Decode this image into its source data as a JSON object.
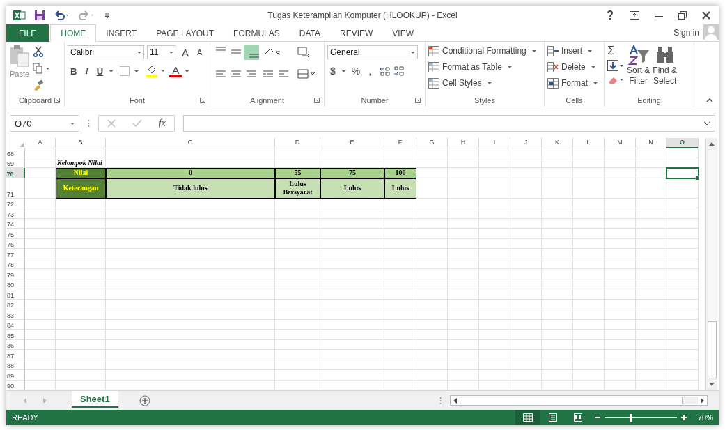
{
  "title_bar": {
    "title": "Tugas Keterampilan Komputer (HLOOKUP) - Excel"
  },
  "tabs": [
    {
      "label": "FILE",
      "kind": "file",
      "selected": false
    },
    {
      "label": "HOME",
      "kind": "tab",
      "selected": true
    },
    {
      "label": "INSERT",
      "kind": "tab",
      "selected": false
    },
    {
      "label": "PAGE LAYOUT",
      "kind": "tab",
      "selected": false
    },
    {
      "label": "FORMULAS",
      "kind": "tab",
      "selected": false
    },
    {
      "label": "DATA",
      "kind": "tab",
      "selected": false
    },
    {
      "label": "REVIEW",
      "kind": "tab",
      "selected": false
    },
    {
      "label": "VIEW",
      "kind": "tab",
      "selected": false
    }
  ],
  "account": {
    "label": "Sign in"
  },
  "ribbon": {
    "clipboard": {
      "paste": "Paste",
      "group": "Clipboard"
    },
    "font": {
      "name": "Calibri",
      "size": "11",
      "grow": "A",
      "shrink": "A",
      "bold": "B",
      "italic": "I",
      "underline": "U",
      "font_color": "A",
      "group": "Font"
    },
    "alignment": {
      "group": "Alignment"
    },
    "number": {
      "format": "General",
      "currency": "$",
      "percent": "%",
      "comma": ",",
      "group": "Number"
    },
    "styles": {
      "buttons": [
        "Conditional Formatting",
        "Format as Table",
        "Cell Styles"
      ],
      "group": "Styles"
    },
    "cells": {
      "buttons": [
        "Insert",
        "Delete",
        "Format"
      ],
      "group": "Cells"
    },
    "editing": {
      "autosum": "Σ",
      "sort_filter": [
        "Sort &",
        "Filter"
      ],
      "find_select": [
        "Find &",
        "Select"
      ],
      "group": "Editing"
    }
  },
  "formula_bar": {
    "name_box": "O70",
    "fx": "fx"
  },
  "sheet": {
    "columns": [
      {
        "label": "A",
        "selected": false
      },
      {
        "label": "B",
        "selected": false
      },
      {
        "label": "C",
        "selected": false
      },
      {
        "label": "D",
        "selected": false
      },
      {
        "label": "E",
        "selected": false
      },
      {
        "label": "F",
        "selected": false
      },
      {
        "label": "G",
        "selected": false
      },
      {
        "label": "H",
        "selected": false
      },
      {
        "label": "I",
        "selected": false
      },
      {
        "label": "J",
        "selected": false
      },
      {
        "label": "K",
        "selected": false
      },
      {
        "label": "L",
        "selected": false
      },
      {
        "label": "M",
        "selected": false
      },
      {
        "label": "N",
        "selected": false
      },
      {
        "label": "O",
        "selected": true
      }
    ],
    "rows": [
      {
        "number": "68",
        "selected": false
      },
      {
        "number": "69",
        "selected": false,
        "cells": [
          null,
          {
            "text": "Kelompok Nilai",
            "kind": "title"
          }
        ]
      },
      {
        "number": "70",
        "selected": true,
        "cells": [
          null,
          {
            "text": "Nilai",
            "kind": "label"
          },
          {
            "text": "0",
            "kind": "header"
          },
          {
            "text": "55",
            "kind": "header"
          },
          {
            "text": "75",
            "kind": "header"
          },
          {
            "text": "100",
            "kind": "header"
          }
        ]
      },
      {
        "number": "71",
        "selected": false,
        "cells": [
          null,
          {
            "text": "Keterangan",
            "kind": "label"
          },
          {
            "text": "Tidak lulus",
            "kind": "body"
          },
          {
            "text": "Lulus Bersyarat",
            "kind": "body"
          },
          {
            "text": "Lulus",
            "kind": "body"
          },
          {
            "text": "Lulus",
            "kind": "body"
          }
        ]
      },
      {
        "number": "72",
        "selected": false
      },
      {
        "number": "73",
        "selected": false
      },
      {
        "number": "74",
        "selected": false
      },
      {
        "number": "75",
        "selected": false
      },
      {
        "number": "76",
        "selected": false
      },
      {
        "number": "77",
        "selected": false
      },
      {
        "number": "78",
        "selected": false
      },
      {
        "number": "79",
        "selected": false
      },
      {
        "number": "80",
        "selected": false
      },
      {
        "number": "81",
        "selected": false
      },
      {
        "number": "82",
        "selected": false
      },
      {
        "number": "83",
        "selected": false
      },
      {
        "number": "84",
        "selected": false
      },
      {
        "number": "85",
        "selected": false
      },
      {
        "number": "86",
        "selected": false
      },
      {
        "number": "87",
        "selected": false
      },
      {
        "number": "88",
        "selected": false
      },
      {
        "number": "89",
        "selected": false
      },
      {
        "number": "90",
        "selected": false
      }
    ]
  },
  "sheet_tabs": [
    {
      "label": "Sheet1",
      "selected": true
    }
  ],
  "status_bar": {
    "status": "READY",
    "views": [
      {
        "kind": "normal",
        "selected": true
      },
      {
        "kind": "layout",
        "selected": false
      },
      {
        "kind": "break",
        "selected": false
      }
    ],
    "zoom": {
      "level": 0.35,
      "label": "70%"
    }
  }
}
